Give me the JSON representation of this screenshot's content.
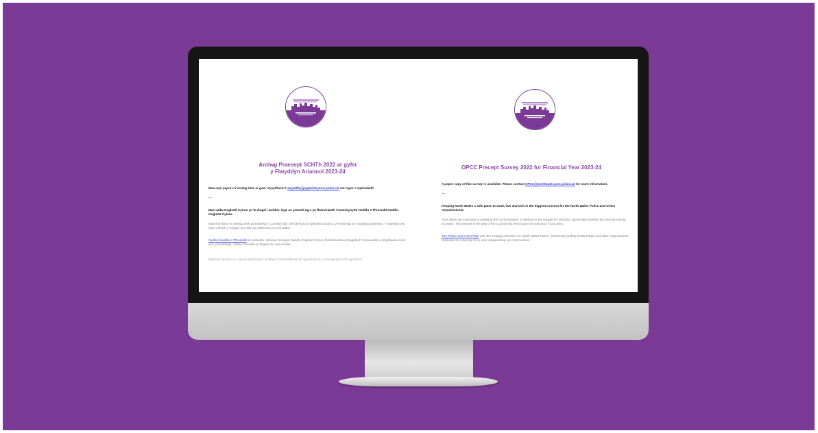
{
  "colors": {
    "background": "#7b3a96",
    "accent": "#8a46a8",
    "link": "#2a3ecc",
    "bezel": "#151515",
    "chin": "#cfcfcf"
  },
  "welsh_doc": {
    "title_line1": "Arolwg Praesept SCHTh 2022 ar gyfer",
    "title_line2": "y Flwyddyn Ariannol 2023-24",
    "intro_before": "Mae copi papur o'r arolwg hwn ar gael. Cysylltwch â ",
    "intro_link": "swyddfa@gogleddcymru.police.uk",
    "intro_after": " am ragor o wybodaeth.",
    "divider": "—",
    "heading": "Mae cadw Gogledd Cymru yn le diogel i weithio, byw ac ymweld ag o yn flaenoriaeth i Gomisiynydd Heddlu a Throsedd Heddlu Gogledd Cymru.",
    "body1": "Mae eich barn yn bwysig wrth gynorthwyo'r Comisiynydd i benderfynu ar gyllideb 2023/24, yn enwedig os cynyddu'r praesept. Y praesept yw'r rhan o Dreth y Cyngor sy'n talu am blismona yn eich ardal.",
    "body2_link": "Cynllun Heddlu a Throsedd",
    "body2_rest": " yn amlinellu cyfeiriad strategol Heddlu Gogledd Cymru, Partneriaethau Diogelwch Cymunedol a sefydliadau eraill sy'n ymroddedig i leihau troseddu a diogelu ein cymunedau.",
    "body3": "Byddwch sicrhau yn cael ei ddefnyddio i hysbysu'r rhanddeiliaid sy'n gwrando ar y Comisiynydd wrth gynllunio"
  },
  "english_doc": {
    "title": "OPCC Precept Survey 2022 for Financial Year 2023-24",
    "intro_before": "A paper copy of this survey is available. Please contact ",
    "intro_link": "OPCC@northwales.pnn.police.uk",
    "intro_after": " for more information.",
    "divider": "—",
    "heading": "Keeping North Wales a safe place to work, live and visit is the biggest concern for the North Wales Police and Crime Commissioner.",
    "body1": "Your views are important in assisting the Commissioner to determine the budget for 2023/24, specifically whether the precept should increase. The precept is the part of the Council Tax which pays for policing in your area.",
    "body2_link": "The Police and Crime Plan",
    "body2_rest": " sets the strategic direction for North Wales Police, Community Safety Partnerships and other organisations dedicated to reducing crime and safeguarding our communities."
  }
}
